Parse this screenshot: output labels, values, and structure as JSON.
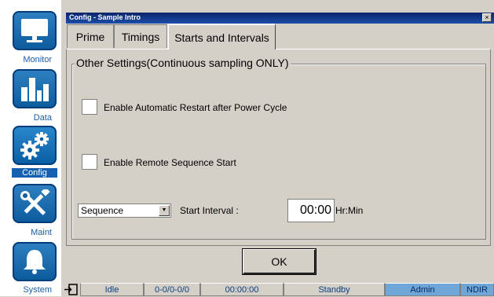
{
  "sidebar": {
    "items": [
      {
        "label": "Monitor"
      },
      {
        "label": "Data"
      },
      {
        "label": "Config"
      },
      {
        "label": "Maint"
      },
      {
        "label": "System"
      }
    ]
  },
  "dialog": {
    "title": "Config - Sample Intro",
    "close_glyph": "×",
    "tabs": [
      {
        "label": "Prime"
      },
      {
        "label": "Timings"
      },
      {
        "label": "Starts and Intervals"
      }
    ],
    "group_title": "Other Settings(Continuous sampling ONLY)",
    "auto_restart_label": "Enable Automatic Restart after Power Cycle",
    "remote_start_label": "Enable Remote Sequence Start",
    "sequence_value": "Sequence",
    "start_interval_label": "Start Interval :",
    "start_interval_value": "00:00",
    "unit_label": "Hr:Min",
    "ok_label": "OK"
  },
  "status": {
    "state": "Idle",
    "counter": "0-0/0-0/0",
    "time": "00:00:00",
    "mode": "Standby",
    "user": "Admin",
    "detector": "NDIR"
  },
  "colors": {
    "nav_button": "#0c5c9e",
    "title_bar": "#0a246a",
    "status_accent": "#6fa6d8"
  }
}
